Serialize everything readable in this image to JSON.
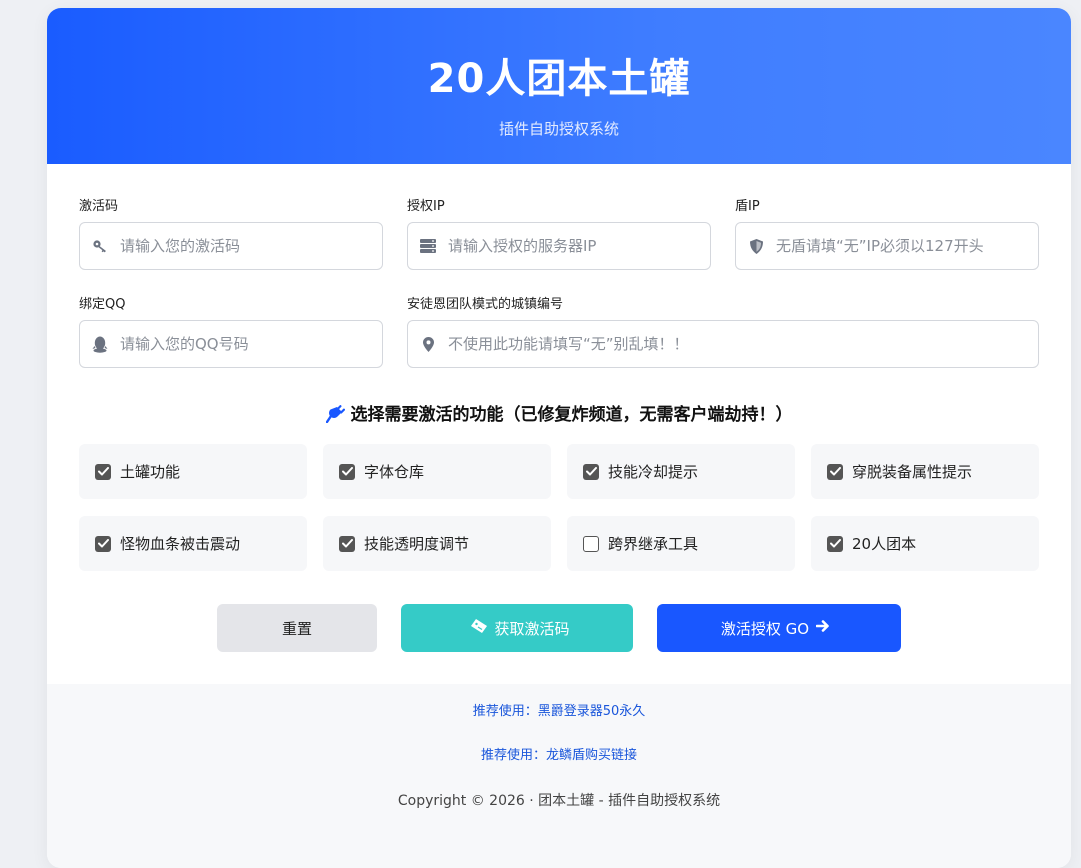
{
  "header": {
    "title": "20人团本土罐",
    "subtitle": "插件自助授权系统"
  },
  "form": {
    "activation_code": {
      "label": "激活码",
      "placeholder": "请输入您的激活码",
      "icon": "key-icon"
    },
    "auth_ip": {
      "label": "授权IP",
      "placeholder": "请输入授权的服务器IP",
      "icon": "server-icon"
    },
    "shield_ip": {
      "label": "盾IP",
      "placeholder": "无盾请填“无”IP必须以127开头",
      "icon": "shield-icon"
    },
    "bind_qq": {
      "label": "绑定QQ",
      "placeholder": "请输入您的QQ号码",
      "icon": "qq-icon"
    },
    "town_code": {
      "label": "安徒恩团队模式的城镇编号",
      "placeholder": "不使用此功能请填写“无”别乱填！！",
      "icon": "location-pin-icon"
    }
  },
  "features": {
    "title": "选择需要激活的功能（已修复炸频道，无需客户端劫持！）",
    "icon": "plug-icon",
    "items": [
      {
        "label": "土罐功能",
        "checked": true
      },
      {
        "label": "字体仓库",
        "checked": true
      },
      {
        "label": "技能冷却提示",
        "checked": true
      },
      {
        "label": "穿脱装备属性提示",
        "checked": true
      },
      {
        "label": "怪物血条被击震动",
        "checked": true
      },
      {
        "label": "技能透明度调节",
        "checked": true
      },
      {
        "label": "跨界继承工具",
        "checked": false
      },
      {
        "label": "20人团本",
        "checked": true
      }
    ]
  },
  "buttons": {
    "reset": "重置",
    "get_code": "获取激活码",
    "activate": "激活授权 GO"
  },
  "footer": {
    "link1": "推荐使用：黑爵登录器50永久",
    "link2": "推荐使用：龙鳞盾购买链接",
    "copyright": "Copyright © 2026 · 团本土罐 - 插件自助授权系统"
  },
  "colors": {
    "primary": "#1957ff",
    "teal": "#35cbc7",
    "header_gradient_start": "#1a5cff",
    "header_gradient_end": "#4a86ff"
  }
}
